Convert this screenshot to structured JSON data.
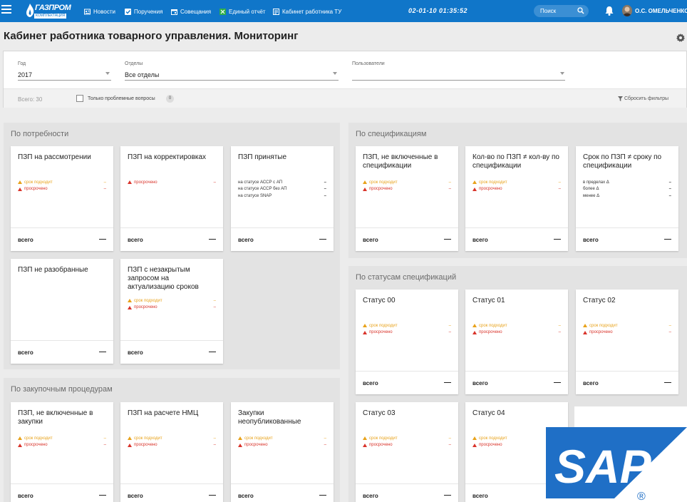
{
  "header": {
    "logo_name": "ГАЗПРОМ",
    "logo_sub": "КОМПЛЕКТАЦИЯ",
    "nav": [
      {
        "label": "Новости",
        "icon": "news-icon"
      },
      {
        "label": "Поручения",
        "icon": "checkbox-icon"
      },
      {
        "label": "Совещания",
        "icon": "calendar-icon"
      },
      {
        "label": "Единый отчёт",
        "icon": "report-icon"
      },
      {
        "label": "Кабинет работника ТУ",
        "icon": "cabinet-icon"
      }
    ],
    "clock": "02-01-10 01:35:52",
    "search_label": "Поиск",
    "user": "О.С. ОМЕЛЬЧЕНКО",
    "colors": {
      "bar": "#1076c9",
      "warn": "#e8a21a",
      "over": "#d9342b"
    }
  },
  "page": {
    "title": "Кабинет работника товарного управления. Мониторинг"
  },
  "filters": {
    "year": {
      "label": "Год",
      "value": "2017"
    },
    "dept": {
      "label": "Отделы",
      "value": "Все отделы"
    },
    "users": {
      "label": "Пользователи",
      "value": ""
    },
    "total": "Всего: 30",
    "only_problem": "Только проблемные вопросы",
    "problem_count": "0",
    "reset": "Сбросить фильтры"
  },
  "common": {
    "warn": "срок подходит",
    "over": "просрочено",
    "total": "всего",
    "dash_small": "–",
    "dash": "—"
  },
  "sections": {
    "needs": {
      "title": "По потребности",
      "cards": [
        {
          "title": "ПЗП на рассмотрении"
        },
        {
          "title": "ПЗП на корректировках"
        },
        {
          "title": "ПЗП принятые",
          "rows": [
            "на статусе АССР с АП",
            "на статусе АССР без АП",
            "на статусе SNAP"
          ]
        },
        {
          "title": "ПЗП не разобранные"
        },
        {
          "title": "ПЗП с незакрытым запросом на актуализацию сроков"
        }
      ]
    },
    "spec": {
      "title": "По спецификациям",
      "cards": [
        {
          "title": "ПЗП, не включенные в спецификации"
        },
        {
          "title": "Кол-во по ПЗП ≠ кол-ву по спецификации"
        },
        {
          "title": "Срок по ПЗП ≠ сроку по спецификации",
          "rows": [
            "в пределах Δ",
            "более Δ",
            "менее Δ"
          ]
        }
      ]
    },
    "status": {
      "title": "По статусам спецификаций",
      "cards": [
        {
          "title": "Статус 00"
        },
        {
          "title": "Статус 01"
        },
        {
          "title": "Статус 02"
        },
        {
          "title": "Статус 03"
        },
        {
          "title": "Статус 04"
        }
      ]
    },
    "proc": {
      "title": "По закупочным процедурам",
      "cards": [
        {
          "title": "ПЗП, не включенные в закупки"
        },
        {
          "title": "ПЗП на расчете НМЦ"
        },
        {
          "title": "Закупки неопубликованные"
        }
      ]
    }
  },
  "watermark": {
    "text": "SAP",
    "mark": "®",
    "color": "#1f6fc6"
  }
}
